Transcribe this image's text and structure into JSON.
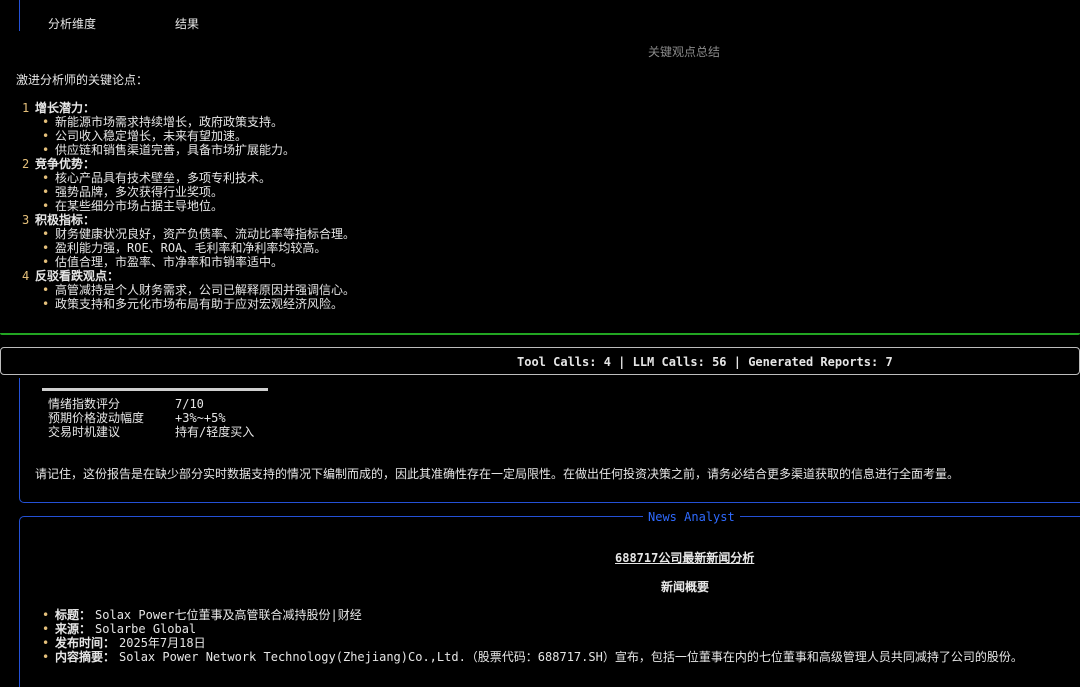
{
  "top_panel": {
    "table_header": {
      "col1": "分析维度",
      "col2": "结果"
    },
    "section_title": "关键观点总结",
    "intro": "激进分析师的关键论点：",
    "groups": [
      {
        "num": "1",
        "title": "增长潜力：",
        "items": [
          "新能源市场需求持续增长，政府政策支持。",
          "公司收入稳定增长，未来有望加速。",
          "供应链和销售渠道完善，具备市场扩展能力。"
        ]
      },
      {
        "num": "2",
        "title": "竞争优势：",
        "items": [
          "核心产品具有技术壁垒，多项专利技术。",
          "强势品牌，多次获得行业奖项。",
          "在某些细分市场占据主导地位。"
        ]
      },
      {
        "num": "3",
        "title": "积极指标：",
        "items": [
          "财务健康状况良好，资产负债率、流动比率等指标合理。",
          "盈利能力强，ROE、ROA、毛利率和净利率均较高。",
          "估值合理，市盈率、市净率和市销率适中。"
        ]
      },
      {
        "num": "4",
        "title": "反驳看跌观点：",
        "items": [
          "高管减持是个人财务需求，公司已解释原因并强调信心。",
          "政策支持和多元化市场布局有助于应对宏观经济风险。"
        ]
      }
    ]
  },
  "status_bar": {
    "text": "Tool Calls: 4 | LLM Calls: 56 | Generated Reports: 7"
  },
  "sentiment": {
    "rows": [
      {
        "label": "情绪指数评分",
        "value": "7/10"
      },
      {
        "label": "预期价格波动幅度",
        "value": "+3%~+5%"
      },
      {
        "label": "交易时机建议",
        "value": "持有/轻度买入"
      }
    ],
    "disclaimer": "请记住，这份报告是在缺少部分实时数据支持的情况下编制而成的，因此其准确性存在一定局限性。在做出任何投资决策之前，请务必结合更多渠道获取的信息进行全面考量。"
  },
  "news": {
    "panel_title": "News Analyst",
    "heading": "688717公司最新新闻分析",
    "subheading": "新闻概要",
    "items": [
      {
        "label": "标题：",
        "value": "Solax Power七位董事及高管联合减持股份|财经"
      },
      {
        "label": "来源：",
        "value": "Solarbe Global"
      },
      {
        "label": "发布时间：",
        "value": "2025年7月18日"
      },
      {
        "label": "内容摘要：",
        "value": "Solax Power Network Technology(Zhejiang)Co.,Ltd.（股票代码：688717.SH）宣布，包括一位董事在内的七位董事和高级管理人员共同减持了公司的股份。"
      }
    ]
  }
}
